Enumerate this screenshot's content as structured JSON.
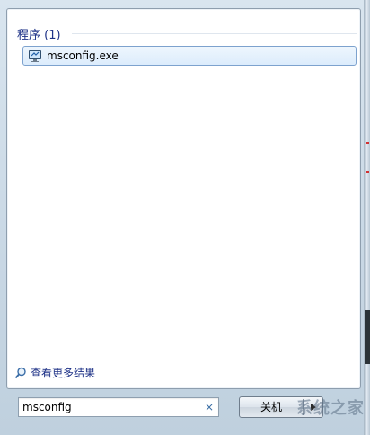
{
  "results": {
    "group_title": "程序 (1)",
    "items": [
      {
        "label": "msconfig.exe",
        "icon": "system-config-icon"
      }
    ]
  },
  "see_more": {
    "label": "查看更多结果",
    "icon": "magnifier-icon"
  },
  "search": {
    "value": "msconfig",
    "clear_symbol": "×"
  },
  "shutdown": {
    "label": "关机",
    "arrow_icon": "triangle-right-icon"
  },
  "watermark": {
    "text": "系统之家"
  },
  "colors": {
    "link": "#1e3287",
    "selection_border": "#7da2ce",
    "selection_fill": "#dcecfc"
  }
}
